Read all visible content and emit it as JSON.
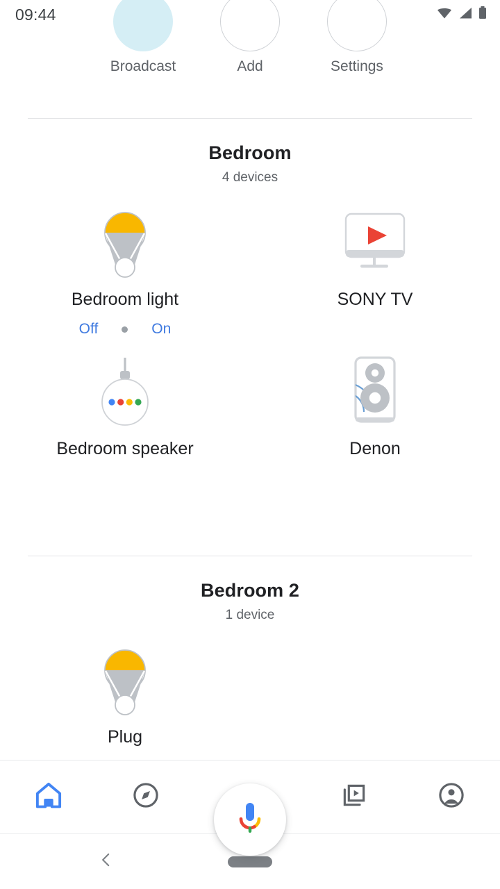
{
  "statusbar": {
    "time": "09:44",
    "icons": [
      "wifi-icon",
      "cellular-signal-icon",
      "battery-icon"
    ]
  },
  "top_actions": [
    {
      "label": "Broadcast",
      "icon": "broadcast-chip-icon",
      "active": true
    },
    {
      "label": "Add",
      "icon": "add-chip-icon",
      "active": false
    },
    {
      "label": "Settings",
      "icon": "settings-chip-icon",
      "active": false
    }
  ],
  "rooms": [
    {
      "title": "Bedroom",
      "device_count_label": "4 devices",
      "devices": [
        {
          "name": "Bedroom light",
          "icon": "light-bulb-icon",
          "controls": {
            "off_label": "Off",
            "on_label": "On"
          }
        },
        {
          "name": "SONY TV",
          "icon": "tv-icon"
        },
        {
          "name": "Bedroom speaker",
          "icon": "google-home-speaker-icon"
        },
        {
          "name": "Denon",
          "icon": "stereo-speaker-icon"
        }
      ]
    },
    {
      "title": "Bedroom 2",
      "device_count_label": "1 device",
      "devices": [
        {
          "name": "Plug",
          "icon": "light-bulb-icon"
        }
      ]
    }
  ],
  "bottom_nav": {
    "items": [
      {
        "name": "home",
        "icon": "home-icon",
        "active": true
      },
      {
        "name": "explore",
        "icon": "compass-icon",
        "active": false
      },
      {
        "name": "assistant",
        "icon": "google-assistant-mic-icon",
        "active": false
      },
      {
        "name": "media",
        "icon": "media-library-icon",
        "active": false
      },
      {
        "name": "account",
        "icon": "account-circle-icon",
        "active": false
      }
    ]
  },
  "android_nav": {
    "back": "back-chevron-icon",
    "home": "home-pill-icon"
  },
  "colors": {
    "accent_blue": "#3f7ae0",
    "home_active_blue": "#4285f4",
    "bulb_yellow": "#f9b700",
    "bulb_gray": "#bdc1c6",
    "play_red": "#ea4335",
    "chip_fill": "#d5eef5",
    "text_primary": "#202124",
    "text_secondary": "#5f6368"
  }
}
